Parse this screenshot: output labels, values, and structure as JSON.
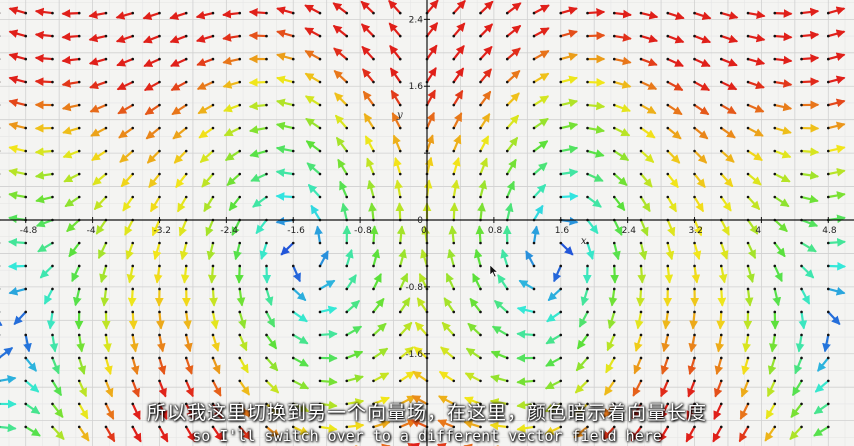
{
  "chart_data": {
    "type": "vector_field",
    "title": "",
    "xlabel": "x",
    "ylabel": "y",
    "xlim": [
      -5.2,
      5.1
    ],
    "ylim": [
      -2.8,
      2.6
    ],
    "x_ticks": [
      -4.8,
      -4,
      -3.2,
      -2.4,
      -1.6,
      -0.8,
      0,
      0.8,
      1.6,
      2.4,
      3.2,
      4,
      4.8
    ],
    "x_tick_labels": [
      "-4.8",
      "-4",
      "-3.2",
      "-2.4",
      "-1.6",
      "-0.8",
      "0",
      "0.8",
      "1.6",
      "2.4",
      "3.2",
      "4",
      "4.8"
    ],
    "y_ticks": [
      2.4,
      1.6,
      0.8,
      0,
      -0.8,
      -1.6
    ],
    "y_tick_labels": [
      "2.4",
      "1.6",
      "",
      "0",
      "-0.8",
      "-1.6"
    ],
    "grid": true,
    "color_meaning": "arrow color encodes vector magnitude",
    "colors": {
      "short": "#1a14d6",
      "medium_low": "#33e8e0",
      "medium": "#5be03a",
      "medium_high": "#f2e61a",
      "long": "#e0201a"
    }
  },
  "subtitles": {
    "chinese": "所以我这里切换到另一个向量场，在这里，颜色暗示着向量长度",
    "english": "so I'll switch over to a different vector field here"
  }
}
